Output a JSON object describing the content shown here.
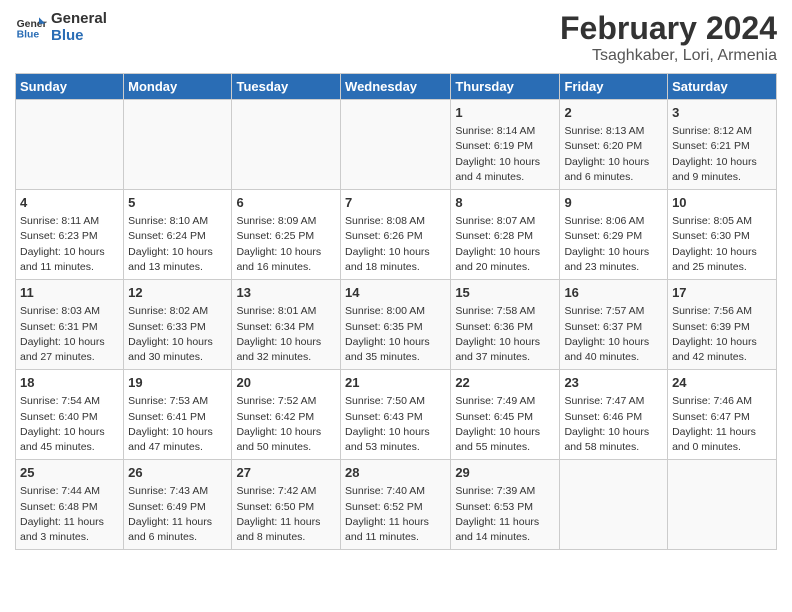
{
  "logo": {
    "text_general": "General",
    "text_blue": "Blue"
  },
  "title": "February 2024",
  "subtitle": "Tsaghkaber, Lori, Armenia",
  "days_of_week": [
    "Sunday",
    "Monday",
    "Tuesday",
    "Wednesday",
    "Thursday",
    "Friday",
    "Saturday"
  ],
  "weeks": [
    [
      {
        "day": "",
        "info": ""
      },
      {
        "day": "",
        "info": ""
      },
      {
        "day": "",
        "info": ""
      },
      {
        "day": "",
        "info": ""
      },
      {
        "day": "1",
        "info": "Sunrise: 8:14 AM\nSunset: 6:19 PM\nDaylight: 10 hours\nand 4 minutes."
      },
      {
        "day": "2",
        "info": "Sunrise: 8:13 AM\nSunset: 6:20 PM\nDaylight: 10 hours\nand 6 minutes."
      },
      {
        "day": "3",
        "info": "Sunrise: 8:12 AM\nSunset: 6:21 PM\nDaylight: 10 hours\nand 9 minutes."
      }
    ],
    [
      {
        "day": "4",
        "info": "Sunrise: 8:11 AM\nSunset: 6:23 PM\nDaylight: 10 hours\nand 11 minutes."
      },
      {
        "day": "5",
        "info": "Sunrise: 8:10 AM\nSunset: 6:24 PM\nDaylight: 10 hours\nand 13 minutes."
      },
      {
        "day": "6",
        "info": "Sunrise: 8:09 AM\nSunset: 6:25 PM\nDaylight: 10 hours\nand 16 minutes."
      },
      {
        "day": "7",
        "info": "Sunrise: 8:08 AM\nSunset: 6:26 PM\nDaylight: 10 hours\nand 18 minutes."
      },
      {
        "day": "8",
        "info": "Sunrise: 8:07 AM\nSunset: 6:28 PM\nDaylight: 10 hours\nand 20 minutes."
      },
      {
        "day": "9",
        "info": "Sunrise: 8:06 AM\nSunset: 6:29 PM\nDaylight: 10 hours\nand 23 minutes."
      },
      {
        "day": "10",
        "info": "Sunrise: 8:05 AM\nSunset: 6:30 PM\nDaylight: 10 hours\nand 25 minutes."
      }
    ],
    [
      {
        "day": "11",
        "info": "Sunrise: 8:03 AM\nSunset: 6:31 PM\nDaylight: 10 hours\nand 27 minutes."
      },
      {
        "day": "12",
        "info": "Sunrise: 8:02 AM\nSunset: 6:33 PM\nDaylight: 10 hours\nand 30 minutes."
      },
      {
        "day": "13",
        "info": "Sunrise: 8:01 AM\nSunset: 6:34 PM\nDaylight: 10 hours\nand 32 minutes."
      },
      {
        "day": "14",
        "info": "Sunrise: 8:00 AM\nSunset: 6:35 PM\nDaylight: 10 hours\nand 35 minutes."
      },
      {
        "day": "15",
        "info": "Sunrise: 7:58 AM\nSunset: 6:36 PM\nDaylight: 10 hours\nand 37 minutes."
      },
      {
        "day": "16",
        "info": "Sunrise: 7:57 AM\nSunset: 6:37 PM\nDaylight: 10 hours\nand 40 minutes."
      },
      {
        "day": "17",
        "info": "Sunrise: 7:56 AM\nSunset: 6:39 PM\nDaylight: 10 hours\nand 42 minutes."
      }
    ],
    [
      {
        "day": "18",
        "info": "Sunrise: 7:54 AM\nSunset: 6:40 PM\nDaylight: 10 hours\nand 45 minutes."
      },
      {
        "day": "19",
        "info": "Sunrise: 7:53 AM\nSunset: 6:41 PM\nDaylight: 10 hours\nand 47 minutes."
      },
      {
        "day": "20",
        "info": "Sunrise: 7:52 AM\nSunset: 6:42 PM\nDaylight: 10 hours\nand 50 minutes."
      },
      {
        "day": "21",
        "info": "Sunrise: 7:50 AM\nSunset: 6:43 PM\nDaylight: 10 hours\nand 53 minutes."
      },
      {
        "day": "22",
        "info": "Sunrise: 7:49 AM\nSunset: 6:45 PM\nDaylight: 10 hours\nand 55 minutes."
      },
      {
        "day": "23",
        "info": "Sunrise: 7:47 AM\nSunset: 6:46 PM\nDaylight: 10 hours\nand 58 minutes."
      },
      {
        "day": "24",
        "info": "Sunrise: 7:46 AM\nSunset: 6:47 PM\nDaylight: 11 hours\nand 0 minutes."
      }
    ],
    [
      {
        "day": "25",
        "info": "Sunrise: 7:44 AM\nSunset: 6:48 PM\nDaylight: 11 hours\nand 3 minutes."
      },
      {
        "day": "26",
        "info": "Sunrise: 7:43 AM\nSunset: 6:49 PM\nDaylight: 11 hours\nand 6 minutes."
      },
      {
        "day": "27",
        "info": "Sunrise: 7:42 AM\nSunset: 6:50 PM\nDaylight: 11 hours\nand 8 minutes."
      },
      {
        "day": "28",
        "info": "Sunrise: 7:40 AM\nSunset: 6:52 PM\nDaylight: 11 hours\nand 11 minutes."
      },
      {
        "day": "29",
        "info": "Sunrise: 7:39 AM\nSunset: 6:53 PM\nDaylight: 11 hours\nand 14 minutes."
      },
      {
        "day": "",
        "info": ""
      },
      {
        "day": "",
        "info": ""
      }
    ]
  ]
}
